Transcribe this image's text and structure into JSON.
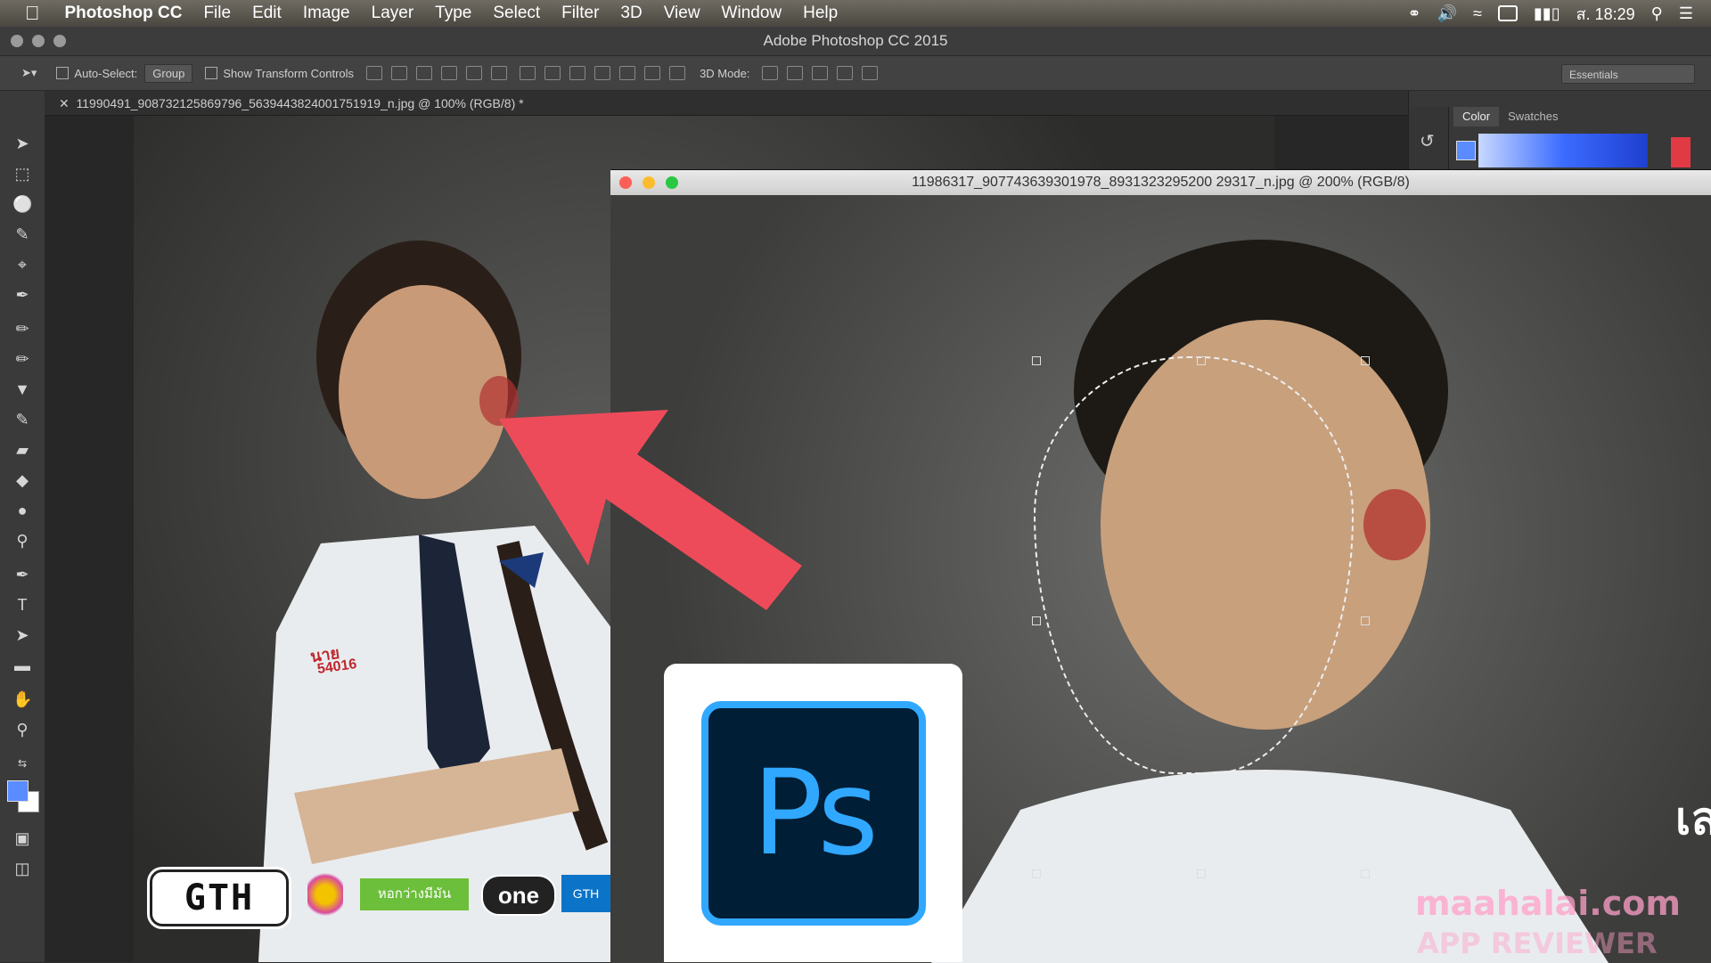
{
  "menubar": {
    "app_name": "Photoshop CC",
    "items": [
      "File",
      "Edit",
      "Image",
      "Layer",
      "Type",
      "Select",
      "Filter",
      "3D",
      "View",
      "Window",
      "Help"
    ],
    "clock": "ส. 18:29"
  },
  "window": {
    "title": "Adobe Photoshop CC 2015"
  },
  "options_bar": {
    "auto_select_label": "Auto-Select:",
    "auto_select_value": "Group",
    "show_transform_label": "Show Transform Controls",
    "mode_3d_label": "3D Mode:",
    "workspace": "Essentials"
  },
  "document_tab": {
    "title": "11990491_908732125869796_5639443824001751919_n.jpg @ 100% (RGB/8) *"
  },
  "document_window2": {
    "title": "11986317_907743639301978_8931323295200 29317_n.jpg @ 200% (RGB/8)"
  },
  "panels": {
    "tabs": [
      "Color",
      "Swatches"
    ],
    "colors": {
      "foreground": "#5a8cff",
      "accent": "#e23a44"
    }
  },
  "overlay": {
    "ps_logo_text": "Ps",
    "ps_logo_bg": "#001e36",
    "ps_logo_fg": "#31a8ff",
    "arrow_color": "#ee4b5a",
    "gth_logo": "GTH",
    "badge_text": "นาย",
    "student_id": "54016",
    "green_logo_text": "หอกว่างมีมัน",
    "one_logo": "one",
    "gth_small": "GTH",
    "watermark_line1": "maahalai.com",
    "watermark_line2": "APP REVIEWER",
    "side_text": "เล"
  }
}
